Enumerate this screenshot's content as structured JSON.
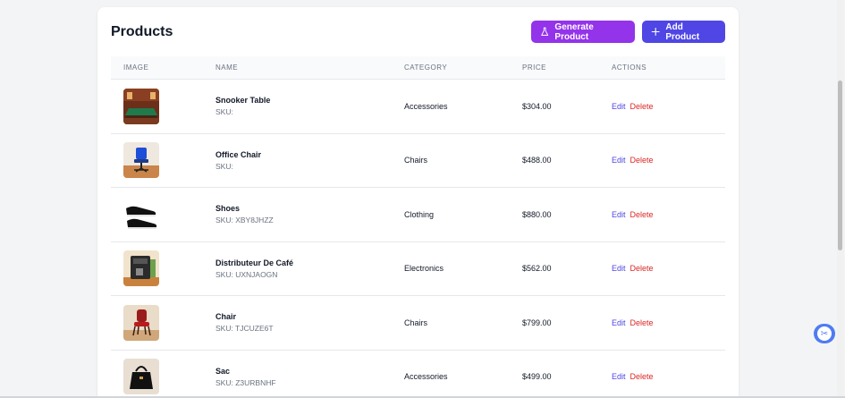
{
  "page": {
    "title": "Products",
    "buttons": {
      "generate": "Generate Product",
      "add": "Add Product"
    }
  },
  "table": {
    "columns": [
      "IMAGE",
      "NAME",
      "CATEGORY",
      "PRICE",
      "ACTIONS"
    ],
    "rows": [
      {
        "name": "Snooker Table",
        "sku": "SKU:",
        "category": "Accessories",
        "price": "$304.00",
        "edit": "Edit",
        "delete": "Delete"
      },
      {
        "name": "Office Chair",
        "sku": "SKU:",
        "category": "Chairs",
        "price": "$488.00",
        "edit": "Edit",
        "delete": "Delete"
      },
      {
        "name": "Shoes",
        "sku": "SKU: XBY8JHZZ",
        "category": "Clothing",
        "price": "$880.00",
        "edit": "Edit",
        "delete": "Delete"
      },
      {
        "name": "Distributeur De Café",
        "sku": "SKU: UXNJAOGN",
        "category": "Electronics",
        "price": "$562.00",
        "edit": "Edit",
        "delete": "Delete"
      },
      {
        "name": "Chair",
        "sku": "SKU: TJCUZE6T",
        "category": "Chairs",
        "price": "$799.00",
        "edit": "Edit",
        "delete": "Delete"
      },
      {
        "name": "Sac",
        "sku": "SKU: Z3URBNHF",
        "category": "Accessories",
        "price": "$499.00",
        "edit": "Edit",
        "delete": "Delete"
      }
    ]
  },
  "colors": {
    "generate_button": "#9333ea",
    "add_button": "#4f46e5",
    "edit_link": "#4f46e5",
    "delete_link": "#dc2626"
  },
  "icons": {
    "generate": "flask-icon",
    "add": "plus-icon",
    "floating": "scissors-icon"
  }
}
